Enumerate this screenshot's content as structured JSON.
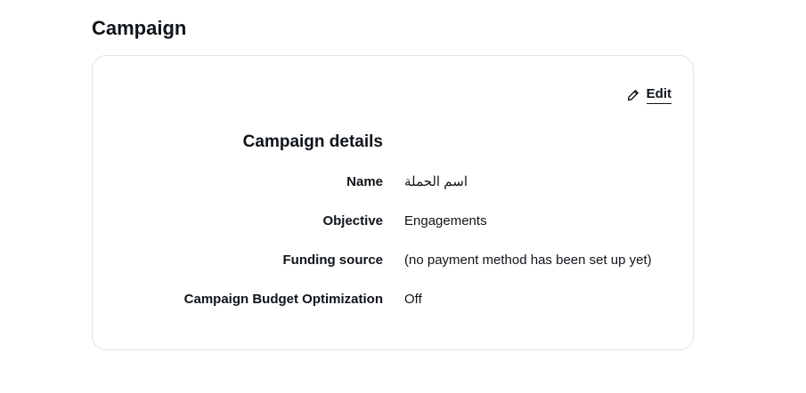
{
  "page": {
    "title": "Campaign"
  },
  "card": {
    "edit_label": "Edit",
    "edit_icon": "pencil-icon",
    "section_title": "Campaign details",
    "rows": [
      {
        "key": "Name",
        "value": "اسم الحملة"
      },
      {
        "key": "Objective",
        "value": "Engagements"
      },
      {
        "key": "Funding source",
        "value": "(no payment method has been set up yet)"
      },
      {
        "key": "Campaign Budget Optimization",
        "value": "Off"
      }
    ]
  },
  "colors": {
    "text": "#0f1419",
    "card_border": "#e1e5e8",
    "background": "#ffffff"
  }
}
